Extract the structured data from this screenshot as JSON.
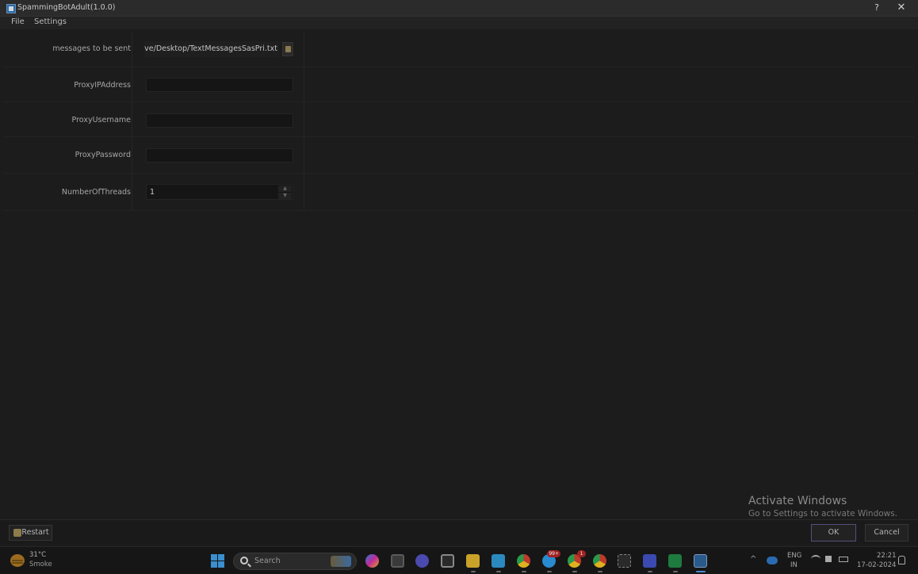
{
  "window": {
    "title": "SpammingBotAdult(1.0.0)",
    "help_label": "?",
    "close_label": "✕"
  },
  "menu": {
    "file": "File",
    "settings": "Settings"
  },
  "form": {
    "messages_label": "messages to be sent",
    "messages_path": "C:/Users/User/OneDrive/Desktop/TextMessagesSasPri.txt",
    "proxy_ip_label": "ProxyIPAddress",
    "proxy_ip_value": "",
    "proxy_user_label": "ProxyUsername",
    "proxy_user_value": "",
    "proxy_pass_label": "ProxyPassword",
    "proxy_pass_value": "",
    "threads_label": "NumberOfThreads",
    "threads_value": "1"
  },
  "buttons": {
    "restart": "Restart",
    "ok": "OK",
    "cancel": "Cancel"
  },
  "watermark": {
    "title": "Activate Windows",
    "subtitle": "Go to Settings to activate Windows."
  },
  "taskbar": {
    "weather_temp": "31°C",
    "weather_desc": "Smoke",
    "search_placeholder": "Search",
    "badges": {
      "telegram": "99+",
      "chrome_1": "1"
    },
    "tray": {
      "chevron": "^",
      "lang_top": "ENG",
      "lang_bottom": "IN",
      "wifi": "wifi-icon",
      "sound": "speaker-icon",
      "battery": "battery-icon",
      "time": "22:21",
      "date": "17-02-2024"
    }
  },
  "colors": {
    "accent_ok_border": "#564e7c",
    "windows_blue": "#3a8fd0"
  }
}
